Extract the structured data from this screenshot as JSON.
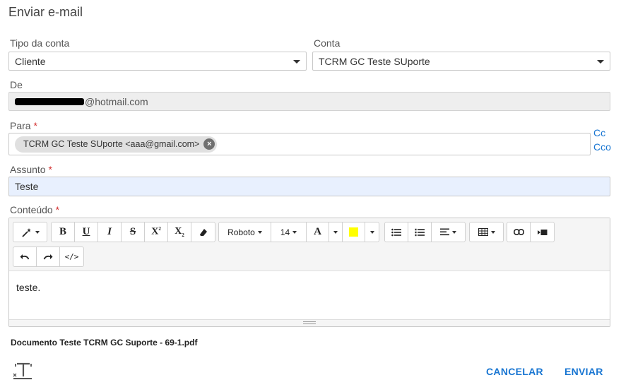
{
  "dialog": {
    "title": "Enviar e-mail"
  },
  "account_type": {
    "label": "Tipo da conta",
    "value": "Cliente"
  },
  "account": {
    "label": "Conta",
    "value": "TCRM GC Teste SUporte"
  },
  "from": {
    "label": "De",
    "value": "@hotmail.com"
  },
  "to": {
    "label": "Para",
    "required_mark": "*",
    "recipient": "TCRM GC Teste SUporte <aaa@gmail.com>",
    "cc_label": "Cc",
    "bcc_label": "Cco"
  },
  "subject": {
    "label": "Assunto",
    "required_mark": "*",
    "value": "Teste"
  },
  "content": {
    "label": "Conteúdo",
    "required_mark": "*",
    "body": "teste.",
    "toolbar": {
      "font_name": "Roboto",
      "font_size": "14",
      "highlight_color": "#ffff00",
      "icons": [
        "magic-icon",
        "bold-icon",
        "underline-icon",
        "italic-icon",
        "strikethrough-icon",
        "superscript-icon",
        "subscript-icon",
        "eraser-icon",
        "font-color-icon",
        "highlight-icon",
        "unordered-list-icon",
        "ordered-list-icon",
        "align-icon",
        "table-icon",
        "link-icon",
        "video-icon",
        "undo-icon",
        "redo-icon",
        "code-view-icon"
      ]
    }
  },
  "attachment": {
    "filename": "Documento Teste TCRM GC Suporte - 69-1.pdf"
  },
  "actions": {
    "cancel": "CANCELAR",
    "send": "ENVIAR"
  },
  "colors": {
    "accent": "#1976d2",
    "required": "#d32f2f",
    "subject_bg": "#e8f0fe"
  }
}
